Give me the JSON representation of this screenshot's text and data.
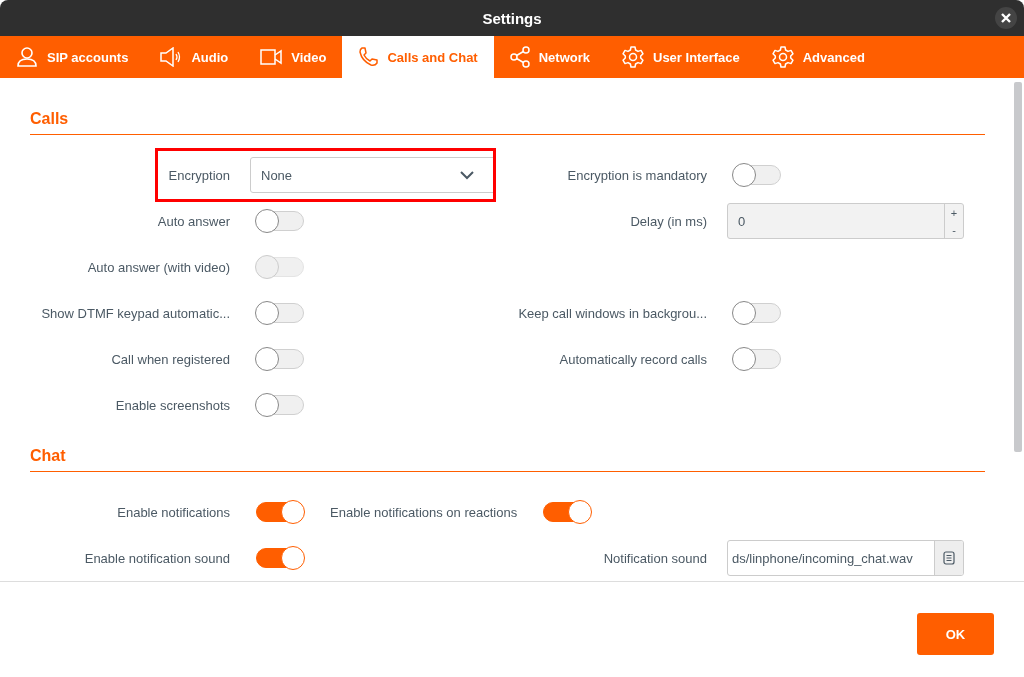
{
  "window": {
    "title": "Settings"
  },
  "tabs": [
    {
      "label": "SIP accounts",
      "selected": false
    },
    {
      "label": "Audio",
      "selected": false
    },
    {
      "label": "Video",
      "selected": false
    },
    {
      "label": "Calls and Chat",
      "selected": true
    },
    {
      "label": "Network",
      "selected": false
    },
    {
      "label": "User Interface",
      "selected": false
    },
    {
      "label": "Advanced",
      "selected": false
    }
  ],
  "sections": [
    {
      "title": "Calls",
      "rows": [
        {
          "left": {
            "kind": "dropdown",
            "label": "Encryption",
            "value": "None",
            "highlighted": true
          },
          "right": {
            "kind": "toggle",
            "label": "Encryption is mandatory",
            "on": false,
            "disabled": false
          }
        },
        {
          "left": {
            "kind": "toggle",
            "label": "Auto answer",
            "on": false,
            "disabled": false
          },
          "right": {
            "kind": "spinbox",
            "label": "Delay (in ms)",
            "value": "0",
            "up": "+",
            "down": "-"
          }
        },
        {
          "left": {
            "kind": "toggle",
            "label": "Auto answer (with video)",
            "on": false,
            "disabled": true
          }
        },
        {
          "left": {
            "kind": "toggle",
            "label": "Show DTMF keypad automatic...",
            "on": false,
            "disabled": false
          },
          "right": {
            "kind": "toggle",
            "label": "Keep call windows in backgrou...",
            "on": false,
            "disabled": false
          }
        },
        {
          "left": {
            "kind": "toggle",
            "label": "Call when registered",
            "on": false,
            "disabled": false
          },
          "right": {
            "kind": "toggle",
            "label": "Automatically record calls",
            "on": false,
            "disabled": false
          }
        },
        {
          "left": {
            "kind": "toggle",
            "label": "Enable screenshots",
            "on": false,
            "disabled": false
          }
        }
      ]
    },
    {
      "title": "Chat",
      "rows": [
        {
          "left": {
            "kind": "toggle",
            "label": "Enable notifications",
            "on": true,
            "disabled": false
          },
          "inline": {
            "kind": "toggle",
            "label": "Enable notifications on reactions",
            "on": true,
            "disabled": false
          }
        },
        {
          "left": {
            "kind": "toggle",
            "label": "Enable notification sound",
            "on": true,
            "disabled": false
          },
          "right": {
            "kind": "file",
            "label": "Notification sound",
            "value": "ds/linphone/incoming_chat.wav"
          }
        }
      ]
    }
  ],
  "footer": {
    "button": "OK"
  }
}
